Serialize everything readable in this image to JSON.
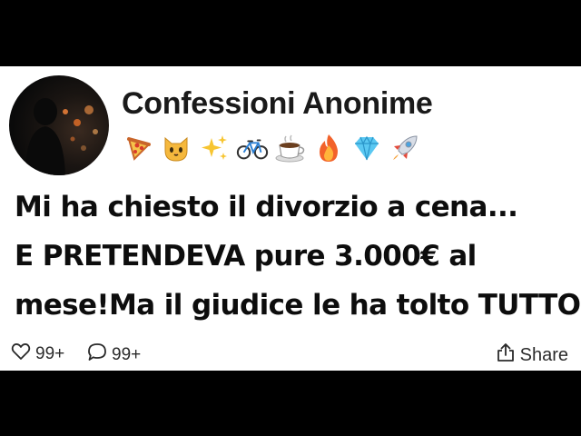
{
  "post": {
    "account_name": "Confessioni Anonime",
    "emojis": [
      "pizza",
      "cat-face",
      "sparkles",
      "bicycle",
      "hot-beverage",
      "fire",
      "gem",
      "rocket"
    ],
    "text_lines": [
      "Mi ha chiesto il divorzio a cena...",
      "E PRETENDEVA pure 3.000€ al",
      "mese!Ma il giudice le ha tolto TUTTO"
    ]
  },
  "actions": {
    "likes_count": "99+",
    "comments_count": "99+",
    "share_label": "Share"
  },
  "colors": {
    "background": "#000000",
    "card": "#ffffff",
    "text": "#0d0d0d"
  }
}
